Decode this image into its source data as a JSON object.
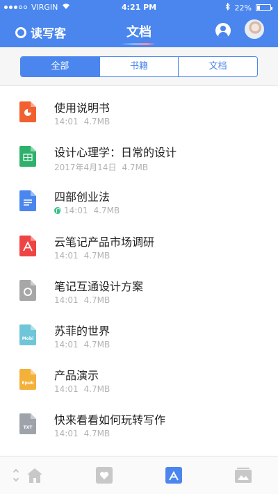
{
  "status_bar": {
    "carrier": "VIRGIN",
    "time": "4:21 PM",
    "battery": "22%",
    "battery_level": 0.22
  },
  "nav": {
    "brand": "读写客",
    "title": "文档"
  },
  "segments": [
    {
      "label": "全部",
      "active": true
    },
    {
      "label": "书籍",
      "active": false
    },
    {
      "label": "文档",
      "active": false
    }
  ],
  "documents": [
    {
      "title": "使用说明书",
      "date": "14:01",
      "size": "4.7MB",
      "type": "ppt",
      "color": "#f0612f",
      "synced": false
    },
    {
      "title": "设计心理学：日常的设计",
      "date": "2017年4月14日",
      "size": "4.7MB",
      "type": "sheet",
      "color": "#2eb26b",
      "synced": false
    },
    {
      "title": "四部创业法",
      "date": "14:01",
      "size": "4.7MB",
      "type": "doc",
      "color": "#4a86ee",
      "synced": true
    },
    {
      "title": "云笔记产品市场调研",
      "date": "14:01",
      "size": "4.7MB",
      "type": "pdf",
      "color": "#ef4444",
      "synced": false
    },
    {
      "title": "笔记互通设计方案",
      "date": "14:01",
      "size": "4.7MB",
      "type": "note",
      "color": "#a7a7a7",
      "synced": false
    },
    {
      "title": "苏菲的世界",
      "date": "14:01",
      "size": "4.7MB",
      "type": "mobi",
      "label": "Mobi",
      "color": "#6fc6d8",
      "synced": false
    },
    {
      "title": "产品演示",
      "date": "14:01",
      "size": "4.7MB",
      "type": "epub",
      "label": "Epub",
      "color": "#f4b13a",
      "synced": false
    },
    {
      "title": "快来看看如何玩转写作",
      "date": "14:01",
      "size": "4.7MB",
      "type": "txt",
      "label": "TXT",
      "color": "#9ea3ab",
      "synced": false
    }
  ],
  "tabbar": {
    "items": [
      {
        "name": "home",
        "active": false
      },
      {
        "name": "favorites",
        "active": false
      },
      {
        "name": "documents",
        "active": true
      },
      {
        "name": "gallery",
        "active": false
      }
    ],
    "active_color": "#4a86ee",
    "inactive_color": "#c8c8c8"
  }
}
